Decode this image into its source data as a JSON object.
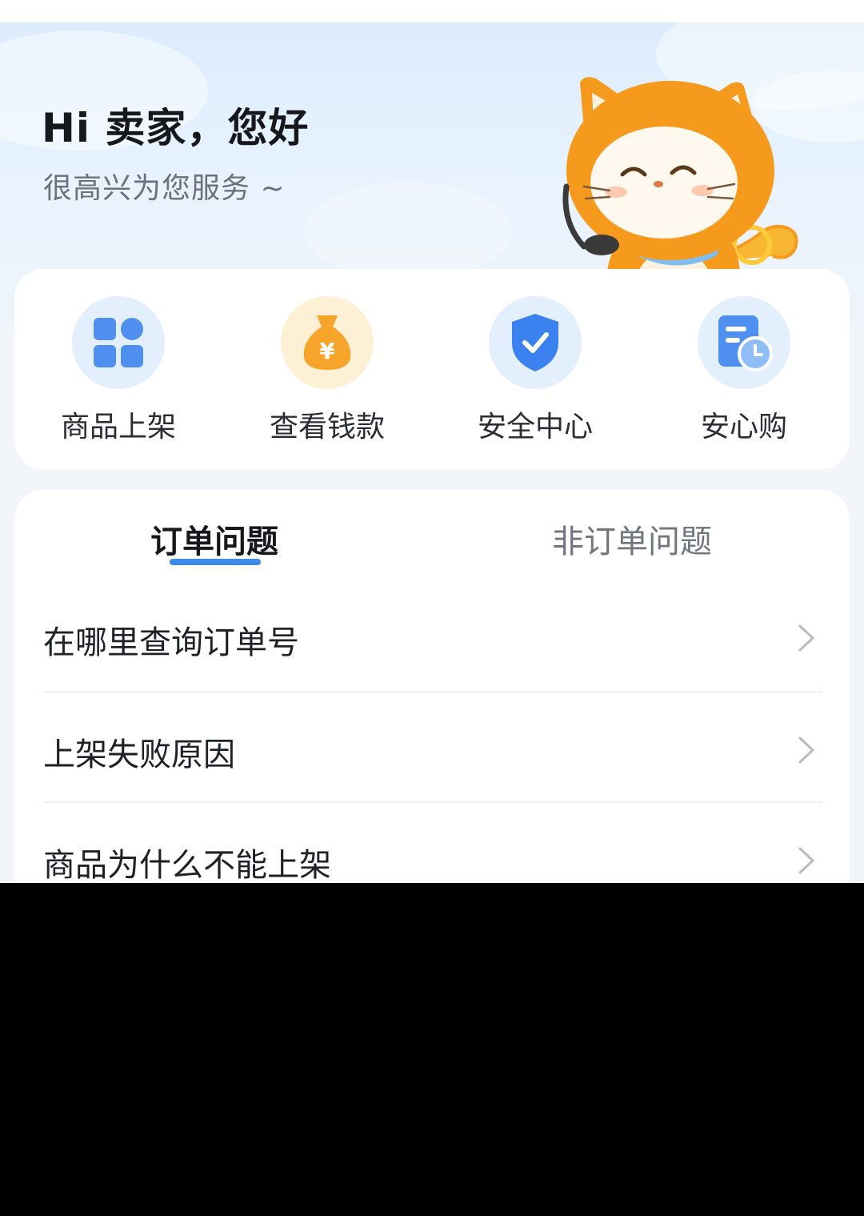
{
  "header": {
    "greeting": "Hi 卖家，您好",
    "subtitle": "很高兴为您服务 ~"
  },
  "quick_actions": [
    {
      "label": "商品上架",
      "icon": "grid-icon",
      "color": "#4f8ff0"
    },
    {
      "label": "查看钱款",
      "icon": "money-bag-icon",
      "color": "#f5a623"
    },
    {
      "label": "安全中心",
      "icon": "shield-check-icon",
      "color": "#3b82f0"
    },
    {
      "label": "安心购",
      "icon": "receipt-clock-icon",
      "color": "#4f8ff0"
    }
  ],
  "tabs": {
    "active": "订单问题",
    "inactive": "非订单问题"
  },
  "faq": [
    {
      "question": "在哪里查询订单号"
    },
    {
      "question": "上架失败原因"
    },
    {
      "question": "商品为什么不能上架"
    }
  ],
  "colors": {
    "accent": "#3d8ce8",
    "hero_background": "#dcecfd",
    "mascot_orange": "#f59a1c"
  }
}
